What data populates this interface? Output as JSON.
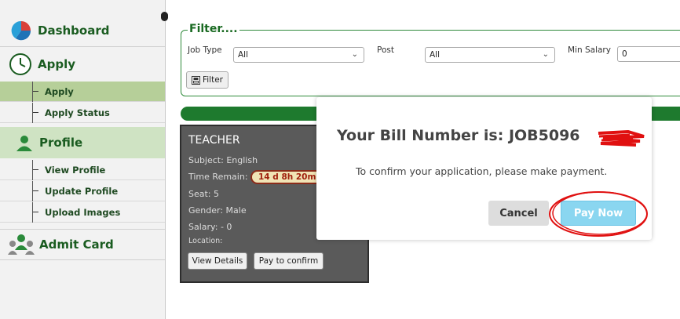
{
  "sidebar": {
    "dashboard": "Dashboard",
    "apply": "Apply",
    "apply_items": [
      "Apply",
      "Apply Status"
    ],
    "profile": "Profile",
    "profile_items": [
      "View Profile",
      "Update Profile",
      "Upload Images"
    ],
    "admit_card": "Admit Card"
  },
  "filter": {
    "legend": "Filter....",
    "job_type_label": "Job Type",
    "job_type_value": "All",
    "post_label": "Post",
    "post_value": "All",
    "min_salary_label": "Min Salary",
    "min_salary_value": "0",
    "button_label": "Filter"
  },
  "card": {
    "title": "TEACHER",
    "subject": "Subject: English",
    "time_label": "Time Remain:",
    "time_value": "14 d 8h 20m",
    "seat": "Seat: 5",
    "gender": "Gender: Male",
    "salary": "Salary: - 0",
    "location": "Location:",
    "view_details": "View Details",
    "pay_to_confirm": "Pay to confirm"
  },
  "modal": {
    "title": "Your Bill Number is: JOB5096",
    "message": "To confirm your application, please make payment.",
    "cancel": "Cancel",
    "pay_now": "Pay Now"
  },
  "colors": {
    "accent_green": "#1e7a2e",
    "pay_blue": "#8ad6f0",
    "annotation_red": "#e01010"
  }
}
